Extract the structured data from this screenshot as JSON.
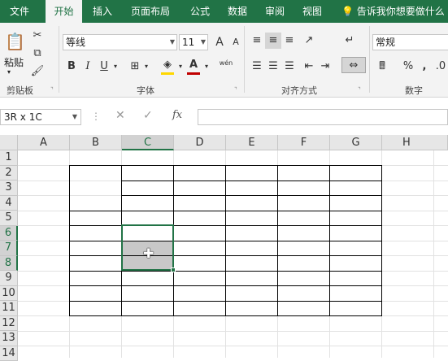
{
  "ribbon_tabs": [
    "文件",
    "开始",
    "插入",
    "页面布局",
    "公式",
    "数据",
    "审阅",
    "视图"
  ],
  "tell_me": "告诉我你想要做什么",
  "clipboard": {
    "paste": "粘贴",
    "group": "剪贴板"
  },
  "font": {
    "name": "等线",
    "size": "11",
    "group": "字体",
    "bold": "B",
    "italic": "I",
    "underline": "U",
    "grow": "A",
    "shrink": "A",
    "phonetic": "wén"
  },
  "alignment": {
    "group": "对齐方式"
  },
  "number": {
    "format": "常规",
    "group": "数字",
    "percent": "%",
    "comma": ","
  },
  "formula_bar": {
    "name_box": "3R x 1C",
    "fx": "fx",
    "cancel": "✕",
    "enter": "✓"
  },
  "columns": [
    "A",
    "B",
    "C",
    "D",
    "E",
    "F",
    "G",
    "H"
  ],
  "rows": [
    "1",
    "2",
    "3",
    "4",
    "5",
    "6",
    "7",
    "8",
    "9",
    "10",
    "11",
    "12",
    "13",
    "14"
  ],
  "selection": {
    "column": "C",
    "rows": [
      "6",
      "7",
      "8"
    ]
  },
  "colors": {
    "accent": "#217346",
    "font_color": "#c00000",
    "fill_color": "#ffd700"
  }
}
